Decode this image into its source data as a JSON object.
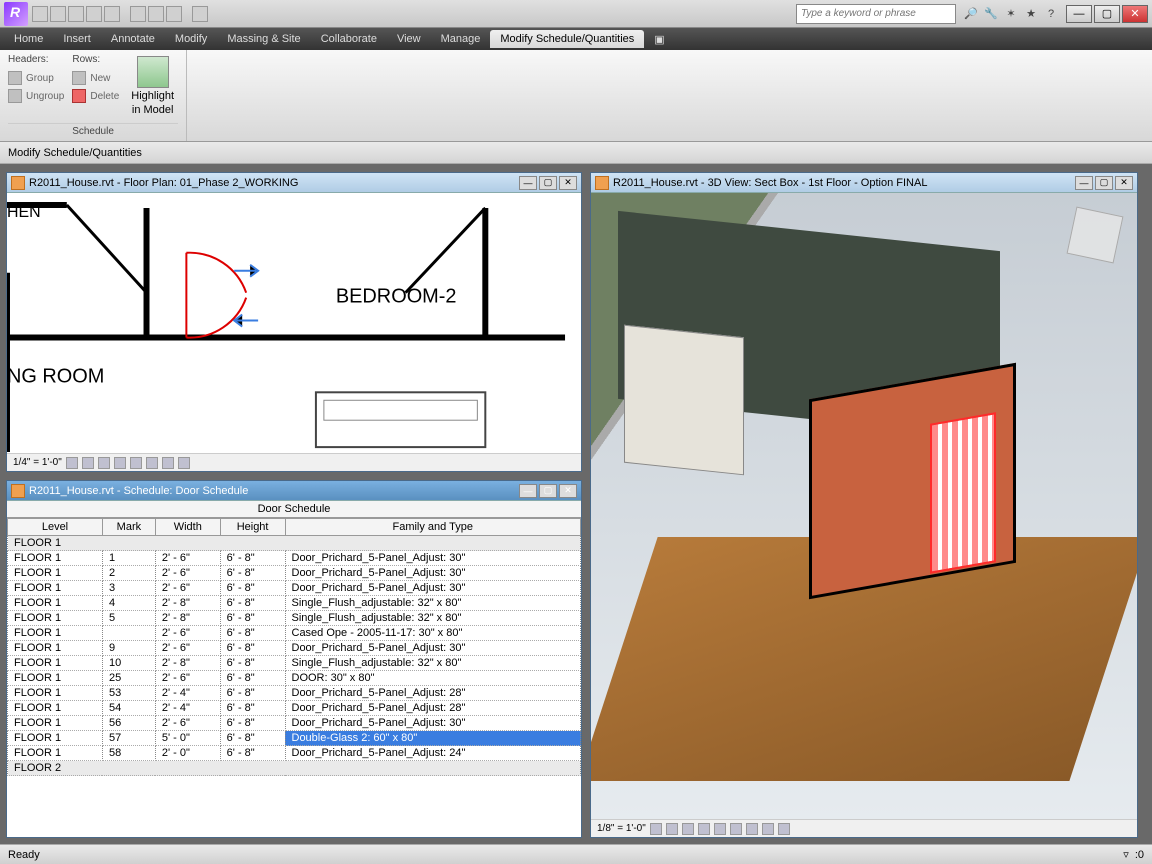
{
  "search_placeholder": "Type a keyword or phrase",
  "menus": [
    "Home",
    "Insert",
    "Annotate",
    "Modify",
    "Massing & Site",
    "Collaborate",
    "View",
    "Manage",
    "Modify Schedule/Quantities"
  ],
  "active_menu": 8,
  "ribbon": {
    "headers_label": "Headers:",
    "group": "Group",
    "ungroup": "Ungroup",
    "rows_label": "Rows:",
    "new": "New",
    "delete": "Delete",
    "highlight_line1": "Highlight",
    "highlight_line2": "in Model",
    "panel_title": "Schedule"
  },
  "options_bar": "Modify Schedule/Quantities",
  "windows": {
    "plan": {
      "title": "R2011_House.rvt - Floor Plan: 01_Phase 2_WORKING",
      "scale": "1/4\" = 1'-0\"",
      "labels": {
        "bedroom": "BEDROOM-2",
        "living": "NG ROOM",
        "kitchen": "HEN"
      }
    },
    "sched": {
      "title": "R2011_House.rvt - Schedule: Door Schedule",
      "heading": "Door Schedule",
      "cols": [
        "Level",
        "Mark",
        "Width",
        "Height",
        "Family and Type"
      ],
      "groups": [
        {
          "name": "FLOOR 1",
          "rows": [
            [
              "FLOOR 1",
              "1",
              "2' - 6\"",
              "6' - 8\"",
              "Door_Prichard_5-Panel_Adjust: 30\""
            ],
            [
              "FLOOR 1",
              "2",
              "2' - 6\"",
              "6' - 8\"",
              "Door_Prichard_5-Panel_Adjust: 30\""
            ],
            [
              "FLOOR 1",
              "3",
              "2' - 6\"",
              "6' - 8\"",
              "Door_Prichard_5-Panel_Adjust: 30\""
            ],
            [
              "FLOOR 1",
              "4",
              "2' - 8\"",
              "6' - 8\"",
              "Single_Flush_adjustable: 32\" x 80\""
            ],
            [
              "FLOOR 1",
              "5",
              "2' - 8\"",
              "6' - 8\"",
              "Single_Flush_adjustable: 32\" x 80\""
            ],
            [
              "FLOOR 1",
              "",
              "2' - 6\"",
              "6' - 8\"",
              "Cased Ope - 2005-11-17: 30\" x 80\""
            ],
            [
              "FLOOR 1",
              "9",
              "2' - 6\"",
              "6' - 8\"",
              "Door_Prichard_5-Panel_Adjust: 30\""
            ],
            [
              "FLOOR 1",
              "10",
              "2' - 8\"",
              "6' - 8\"",
              "Single_Flush_adjustable: 32\" x 80\""
            ],
            [
              "FLOOR 1",
              "25",
              "2' - 6\"",
              "6' - 8\"",
              "DOOR: 30\" x 80\""
            ],
            [
              "FLOOR 1",
              "53",
              "2' - 4\"",
              "6' - 8\"",
              "Door_Prichard_5-Panel_Adjust: 28\""
            ],
            [
              "FLOOR 1",
              "54",
              "2' - 4\"",
              "6' - 8\"",
              "Door_Prichard_5-Panel_Adjust: 28\""
            ],
            [
              "FLOOR 1",
              "56",
              "2' - 6\"",
              "6' - 8\"",
              "Door_Prichard_5-Panel_Adjust: 30\""
            ],
            [
              "FLOOR 1",
              "57",
              "5' - 0\"",
              "6' - 8\"",
              "Double-Glass 2: 60\" x 80\""
            ],
            [
              "FLOOR 1",
              "58",
              "2' - 0\"",
              "6' - 8\"",
              "Door_Prichard_5-Panel_Adjust: 24\""
            ]
          ],
          "selected_row": 12
        },
        {
          "name": "FLOOR 2",
          "rows": []
        }
      ]
    },
    "view3d": {
      "title": "R2011_House.rvt - 3D View: Sect Box - 1st Floor - Option FINAL",
      "scale": "1/8\" = 1'-0\""
    }
  },
  "status": {
    "left": "Ready",
    "filter_count": ":0"
  }
}
